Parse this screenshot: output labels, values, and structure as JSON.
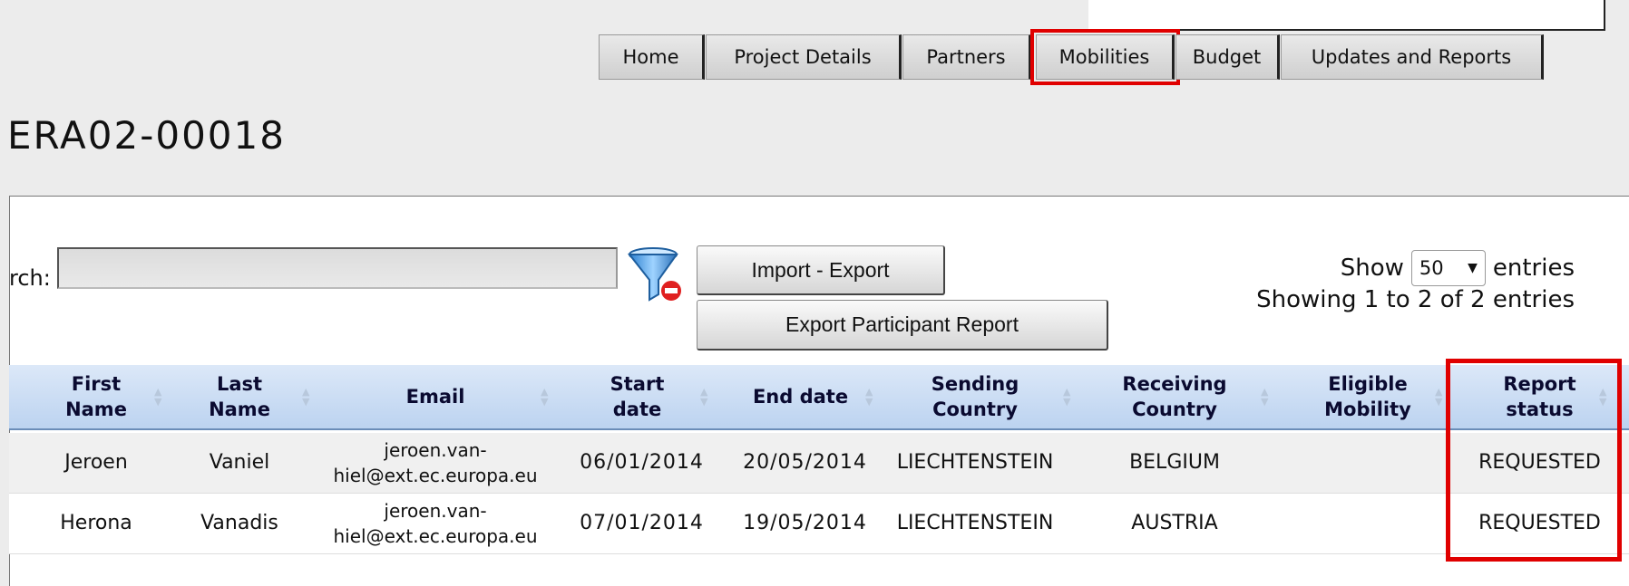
{
  "nav": {
    "tabs": [
      {
        "label": "Home"
      },
      {
        "label": "Project Details"
      },
      {
        "label": "Partners"
      },
      {
        "label": "Mobilities"
      },
      {
        "label": "Budget"
      },
      {
        "label": "Updates and Reports"
      }
    ]
  },
  "page_title": "ERA02-00018",
  "search": {
    "label": "rch:",
    "value": ""
  },
  "buttons": {
    "import_export": "Import - Export",
    "export_participant_report": "Export Participant Report"
  },
  "length_menu": {
    "show": "Show",
    "selected": "50",
    "entries": "entries"
  },
  "info": "Showing 1 to 2 of 2 entries",
  "table": {
    "headers": [
      {
        "l1": "First",
        "l2": "Name"
      },
      {
        "l1": "Last",
        "l2": "Name"
      },
      {
        "l1": "Email",
        "l2": ""
      },
      {
        "l1": "Start",
        "l2": "date"
      },
      {
        "l1": "End date",
        "l2": ""
      },
      {
        "l1": "Sending",
        "l2": "Country"
      },
      {
        "l1": "Receiving",
        "l2": "Country"
      },
      {
        "l1": "Eligible",
        "l2": "Mobility"
      },
      {
        "l1": "Report",
        "l2": "status"
      }
    ],
    "rows": [
      {
        "first_name": "Jeroen",
        "last_name": "Vaniel",
        "email_l1": "jeroen.van-",
        "email_l2": "hiel@ext.ec.europa.eu",
        "start_date": "06/01/2014",
        "end_date": "20/05/2014",
        "sending_country": "LIECHTENSTEIN",
        "receiving_country": "BELGIUM",
        "eligible_mobility": "",
        "report_status": "REQUESTED"
      },
      {
        "first_name": "Herona",
        "last_name": "Vanadis",
        "email_l1": "jeroen.van-",
        "email_l2": "hiel@ext.ec.europa.eu",
        "start_date": "07/01/2014",
        "end_date": "19/05/2014",
        "sending_country": "LIECHTENSTEIN",
        "receiving_country": "AUSTRIA",
        "eligible_mobility": "",
        "report_status": "REQUESTED"
      }
    ]
  },
  "colors": {
    "highlight": "#e00000",
    "header_bg": "#bcd3f0"
  }
}
